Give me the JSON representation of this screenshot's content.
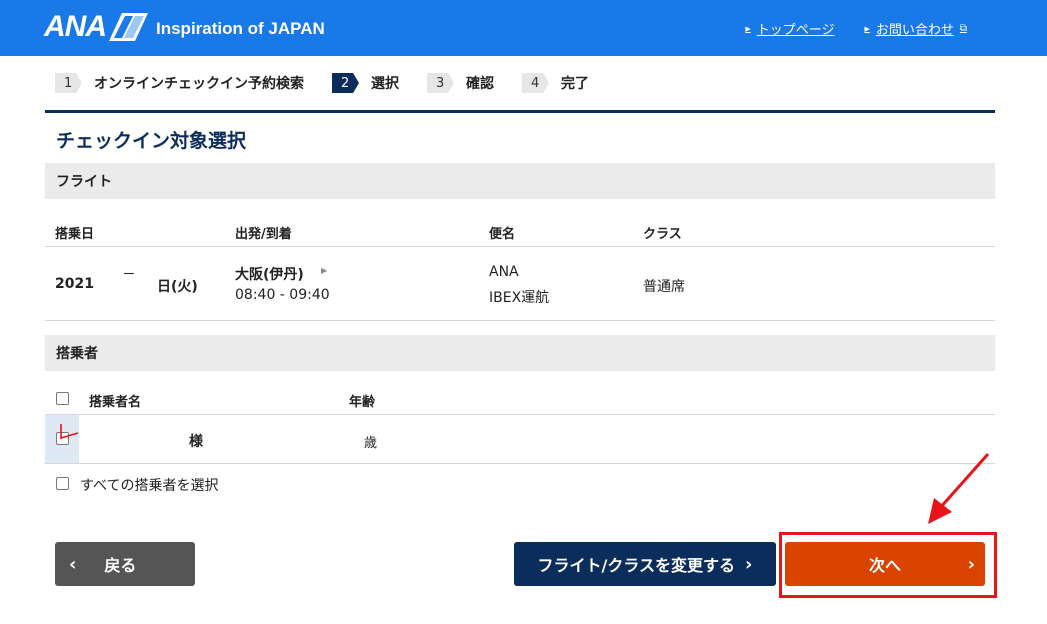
{
  "header": {
    "logo_text": "ANA",
    "tagline": "Inspiration of JAPAN",
    "links": [
      {
        "label": "トップページ"
      },
      {
        "label": "お問い合わせ"
      }
    ]
  },
  "steps": [
    {
      "num": "1",
      "label": "オンラインチェックイン予約検索"
    },
    {
      "num": "2",
      "label": "選択"
    },
    {
      "num": "3",
      "label": "確認"
    },
    {
      "num": "4",
      "label": "完了"
    }
  ],
  "page_title": "チェックイン対象選択",
  "flight": {
    "section_label": "フライト",
    "headers": {
      "date": "搭乗日",
      "route": "出発/到着",
      "flight_no": "便名",
      "class": "クラス"
    },
    "row": {
      "date": "2021",
      "date_sep": "ー",
      "date_day": "日(火)",
      "route": "大阪(伊丹)",
      "time": "08:40 - 09:40",
      "flight_no": "ANA",
      "operator": "IBEX運航",
      "class": "普通席"
    }
  },
  "passengers": {
    "section_label": "搭乗者",
    "headers": {
      "name": "搭乗者名",
      "age": "年齢"
    },
    "rows": [
      {
        "name_suffix": "様",
        "age_suffix": "歳"
      }
    ],
    "select_all_label": "すべての搭乗者を選択"
  },
  "buttons": {
    "back": "戻る",
    "change": "フライト/クラスを変更する",
    "next": "次へ"
  },
  "colors": {
    "header_bg": "#1a79e8",
    "navy": "#0b2d5c",
    "next_orange": "#d94400",
    "annotation_red": "#e8141a"
  }
}
